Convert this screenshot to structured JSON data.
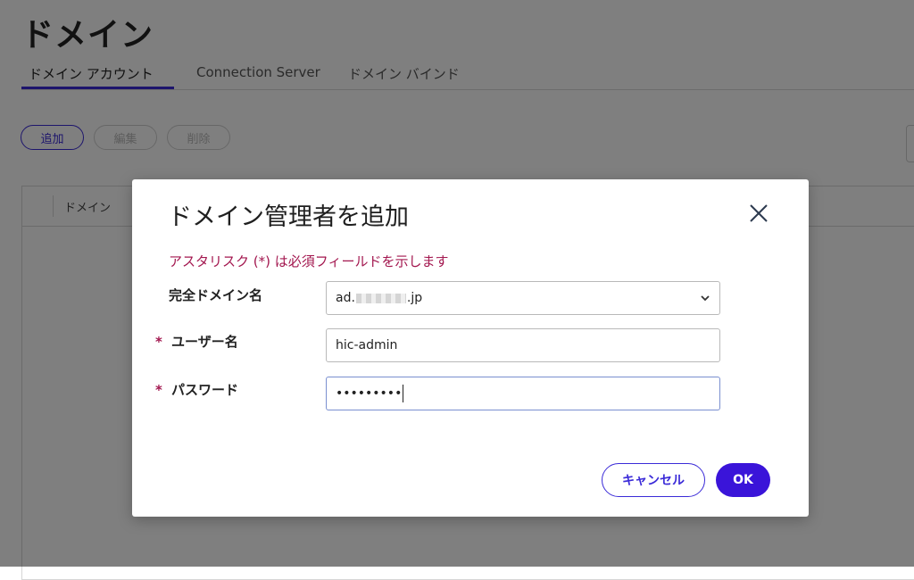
{
  "page": {
    "title": "ドメイン",
    "tabs": [
      {
        "label": "ドメイン アカウント",
        "active": true
      },
      {
        "label": "Connection Server",
        "active": false
      },
      {
        "label": "ドメイン バインド",
        "active": false
      }
    ],
    "toolbar": {
      "add_label": "追加",
      "edit_label": "編集",
      "delete_label": "削除"
    },
    "table": {
      "columns": [
        "ドメイン"
      ]
    }
  },
  "dialog": {
    "title": "ドメイン管理者を追加",
    "close_icon": "close-icon",
    "required_note": "アスタリスク (*) は必須フィールドを示します",
    "required_marker": "*",
    "fields": {
      "domain": {
        "label": "完全ドメイン名",
        "value_prefix": "ad.",
        "value_suffix": ".jp"
      },
      "username": {
        "label": "ユーザー名",
        "value": "hic-admin"
      },
      "password": {
        "label": "パスワード",
        "value": "•••••••••"
      }
    },
    "buttons": {
      "cancel_label": "キャンセル",
      "ok_label": "OK"
    }
  },
  "colors": {
    "accent": "#3a14d9",
    "required": "#a3174f",
    "overlay": "rgba(0,0,0,0.5)"
  }
}
